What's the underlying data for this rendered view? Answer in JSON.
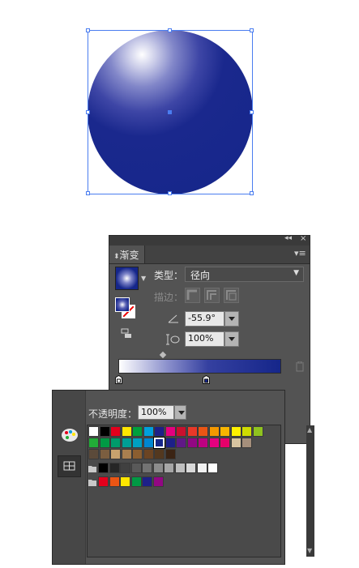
{
  "artwork": {
    "sphere_gradient_colors": [
      "#ffffff",
      "#8287c9",
      "#1a288d"
    ]
  },
  "gradient_panel": {
    "tab_label": "渐变",
    "collapse_icon": "double-chevron-left-icon",
    "close_icon": "close-icon",
    "menu_icon": "panel-menu-icon",
    "type_label": "类型：",
    "type_value": "径向",
    "stroke_label": "描边：",
    "angle_value": "-55.9°",
    "aspect_value": "100%",
    "gradient_start_color": "#ffffff",
    "gradient_end_color": "#15268a"
  },
  "swatches_panel": {
    "opacity_label": "不透明度：",
    "opacity_value": "100%",
    "row1": [
      "#ffffff",
      "#000000",
      "#e4001c",
      "#ffe600",
      "#00a03c",
      "#00a0dc",
      "#1d2088",
      "#e4007f",
      "#c8102e",
      "#e83828",
      "#ea5514",
      "#f39800",
      "#f8b500",
      "#fff100",
      "#cfdb00",
      "#8fc31f"
    ],
    "row2": [
      "#22ac38",
      "#009944",
      "#009b6b",
      "#009e96",
      "#00a0c1",
      "#0086d1",
      "#15268a",
      "#1d2088",
      "#601986",
      "#920783",
      "#be0081",
      "#e4007f",
      "#e5006a",
      "#d7c4a0",
      "#a58f7b"
    ],
    "row3": [
      "#5b4a3a",
      "#7b5e40",
      "#c7a26e",
      "#a87f4f",
      "#8b5e30",
      "#6b4423",
      "#53381f",
      "#3b2414"
    ],
    "row4": [
      "#000000",
      "#262626",
      "#404040",
      "#595959",
      "#737373",
      "#8c8c8c",
      "#a6a6a6",
      "#bfbfbf",
      "#d9d9d9",
      "#f2f2f2",
      "#ffffff"
    ],
    "row5": [
      "#e4001c",
      "#ea5514",
      "#ffe600",
      "#009944",
      "#1d2088",
      "#920783"
    ]
  }
}
